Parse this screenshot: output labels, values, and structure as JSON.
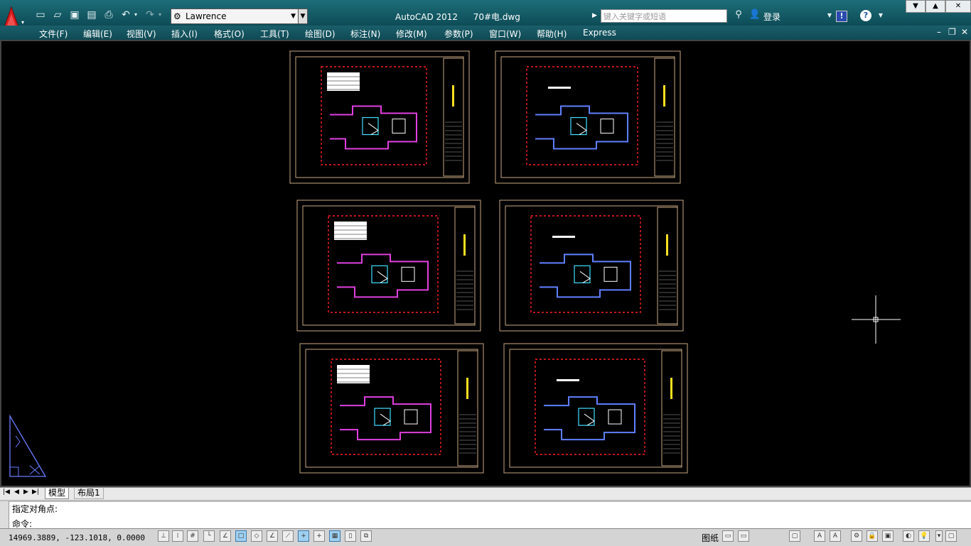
{
  "window": {
    "app_title": "AutoCAD 2012",
    "file_name": "70#电.dwg",
    "workspace": "Lawrence",
    "search_placeholder": "键入关键字或短语",
    "login_label": "登录"
  },
  "menu": [
    "文件(F)",
    "编辑(E)",
    "视图(V)",
    "插入(I)",
    "格式(O)",
    "工具(T)",
    "绘图(D)",
    "标注(N)",
    "修改(M)",
    "参数(P)",
    "窗口(W)",
    "帮助(H)",
    "Express"
  ],
  "tabs": {
    "model": "模型",
    "layout1": "布局1"
  },
  "command": {
    "history_line": "指定对角点:",
    "prompt": "命令:"
  },
  "status": {
    "coordinates": "14969.3889, -123.1018, 0.0000",
    "paper_label": "图纸"
  },
  "icons": {
    "app_menu": "autocad-logo-icon",
    "crosshair": "crosshair-cursor"
  },
  "colors": {
    "title_bar": "#0d4c57",
    "canvas": "#000000",
    "drawing_frame": "#c8a882",
    "walls_red": "#ff2020",
    "walls_magenta": "#e040e0",
    "walls_blue": "#6080ff"
  }
}
